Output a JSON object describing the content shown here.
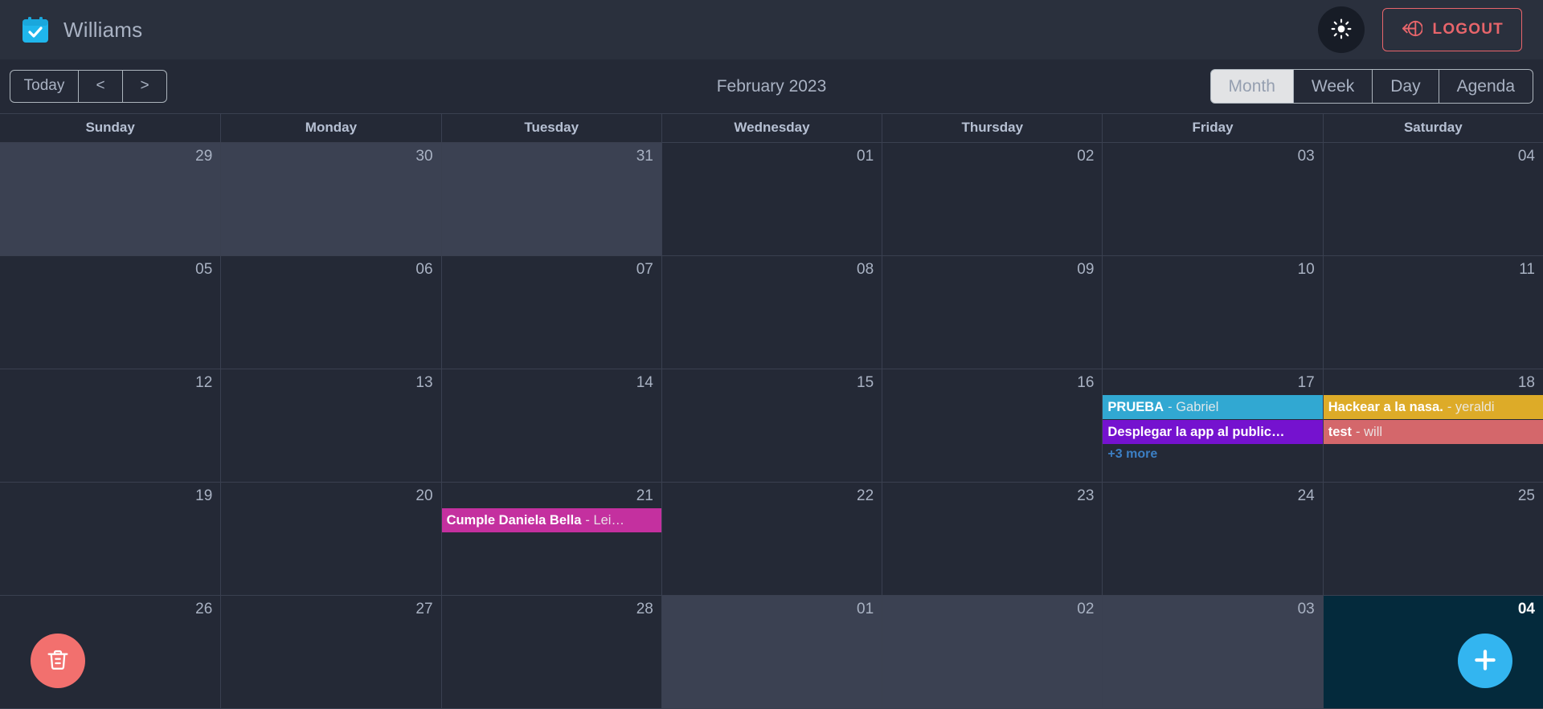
{
  "app": {
    "brand_title": "Williams",
    "logo_icon": "calendar-check-icon",
    "theme_toggle_icon": "sun-icon",
    "logout_icon": "logout-arrow-icon",
    "logout_label": "LOGOUT"
  },
  "toolbar": {
    "today_label": "Today",
    "prev_label": "<",
    "next_label": ">",
    "title": "February 2023",
    "views": [
      {
        "label": "Month",
        "active": true
      },
      {
        "label": "Week",
        "active": false
      },
      {
        "label": "Day",
        "active": false
      },
      {
        "label": "Agenda",
        "active": false
      }
    ]
  },
  "calendar": {
    "weekdays": [
      "Sunday",
      "Monday",
      "Tuesday",
      "Wednesday",
      "Thursday",
      "Friday",
      "Saturday"
    ],
    "more_label": "+3 more",
    "weeks": [
      [
        {
          "num": "29",
          "off": true,
          "today": false,
          "events": []
        },
        {
          "num": "30",
          "off": true,
          "today": false,
          "events": []
        },
        {
          "num": "31",
          "off": true,
          "today": false,
          "events": []
        },
        {
          "num": "01",
          "off": false,
          "today": false,
          "events": []
        },
        {
          "num": "02",
          "off": false,
          "today": false,
          "events": []
        },
        {
          "num": "03",
          "off": false,
          "today": false,
          "events": []
        },
        {
          "num": "04",
          "off": false,
          "today": false,
          "events": []
        }
      ],
      [
        {
          "num": "05",
          "off": false,
          "today": false,
          "events": []
        },
        {
          "num": "06",
          "off": false,
          "today": false,
          "events": []
        },
        {
          "num": "07",
          "off": false,
          "today": false,
          "events": []
        },
        {
          "num": "08",
          "off": false,
          "today": false,
          "events": []
        },
        {
          "num": "09",
          "off": false,
          "today": false,
          "events": []
        },
        {
          "num": "10",
          "off": false,
          "today": false,
          "events": []
        },
        {
          "num": "11",
          "off": false,
          "today": false,
          "events": []
        }
      ],
      [
        {
          "num": "12",
          "off": false,
          "today": false,
          "events": []
        },
        {
          "num": "13",
          "off": false,
          "today": false,
          "events": []
        },
        {
          "num": "14",
          "off": false,
          "today": false,
          "events": []
        },
        {
          "num": "15",
          "off": false,
          "today": false,
          "events": []
        },
        {
          "num": "16",
          "off": false,
          "today": false,
          "events": []
        },
        {
          "num": "17",
          "off": false,
          "today": false,
          "more": "+3 more",
          "events": [
            {
              "title": "PRUEBA",
              "owner": "- Gabriel",
              "color": "#31A8D2"
            },
            {
              "title": "Desplegar la app al public…",
              "owner": "",
              "color": "#7512CF"
            }
          ]
        },
        {
          "num": "18",
          "off": false,
          "today": false,
          "events": [
            {
              "title": "Hackear a la nasa.",
              "owner": "- yeraldi",
              "color": "#DDAB28"
            },
            {
              "title": "test",
              "owner": "- will",
              "color": "#D4676B"
            }
          ]
        }
      ],
      [
        {
          "num": "19",
          "off": false,
          "today": false,
          "events": []
        },
        {
          "num": "20",
          "off": false,
          "today": false,
          "events": []
        },
        {
          "num": "21",
          "off": false,
          "today": false,
          "events": [
            {
              "title": "Cumple Daniela Bella",
              "owner": "- Lei…",
              "color": "#C4309F"
            }
          ]
        },
        {
          "num": "22",
          "off": false,
          "today": false,
          "events": []
        },
        {
          "num": "23",
          "off": false,
          "today": false,
          "events": []
        },
        {
          "num": "24",
          "off": false,
          "today": false,
          "events": []
        },
        {
          "num": "25",
          "off": false,
          "today": false,
          "events": []
        }
      ],
      [
        {
          "num": "26",
          "off": false,
          "today": false,
          "events": []
        },
        {
          "num": "27",
          "off": false,
          "today": false,
          "events": []
        },
        {
          "num": "28",
          "off": false,
          "today": false,
          "events": []
        },
        {
          "num": "01",
          "off": true,
          "today": false,
          "events": []
        },
        {
          "num": "02",
          "off": true,
          "today": false,
          "events": []
        },
        {
          "num": "03",
          "off": true,
          "today": false,
          "events": []
        },
        {
          "num": "04",
          "off": false,
          "today": true,
          "events": []
        }
      ]
    ]
  },
  "fab": {
    "delete_icon": "trash-icon",
    "add_icon": "plus-icon"
  },
  "colors": {
    "accent": "#33B5F0",
    "danger": "#F2706E",
    "page_bg": "#242936",
    "appbar_bg": "#2A303D",
    "offmonth_bg": "#3B4152",
    "today_bg": "#042A3C"
  }
}
